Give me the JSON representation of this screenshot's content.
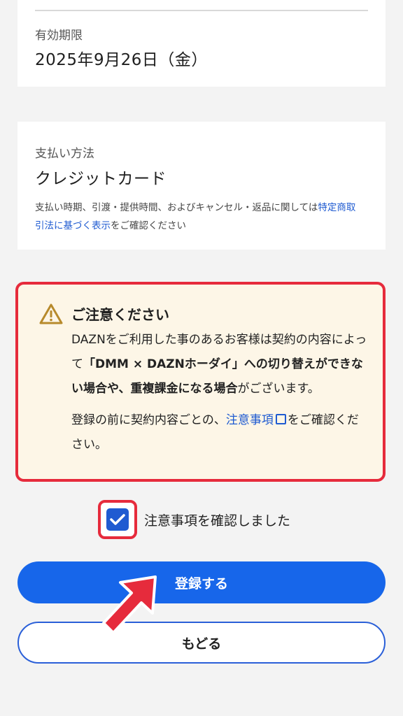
{
  "expiry": {
    "label": "有効期限",
    "value": "2025年9月26日（金）"
  },
  "payment": {
    "label": "支払い方法",
    "value": "クレジットカード",
    "note_prefix": "支払い時期、引渡・提供時間、およびキャンセル・返品に関しては",
    "note_link": "特定商取引法に基づく表示",
    "note_suffix": "をご確認ください"
  },
  "warning": {
    "icon": "warning-triangle-icon",
    "title": "ご注意ください",
    "p1_a": "DAZNをご利用した事のあるお客様は契約の内容によって",
    "p1_b": "「DMM × DAZNホーダイ」への切り替えができない場合や、重複課金になる場合",
    "p1_c": "がございます。",
    "p2_a": "登録の前に契約内容ごとの、",
    "p2_link": "注意事項",
    "p2_b": "をご確認ください。"
  },
  "consent": {
    "label": "注意事項を確認しました",
    "checked": true
  },
  "buttons": {
    "register": "登録する",
    "back": "もどる"
  },
  "colors": {
    "accent": "#1766ea",
    "link": "#1f5bd1",
    "highlight": "#e62b3c",
    "warning_bg": "#fdf6e7",
    "warning_icon": "#b78a2c"
  }
}
